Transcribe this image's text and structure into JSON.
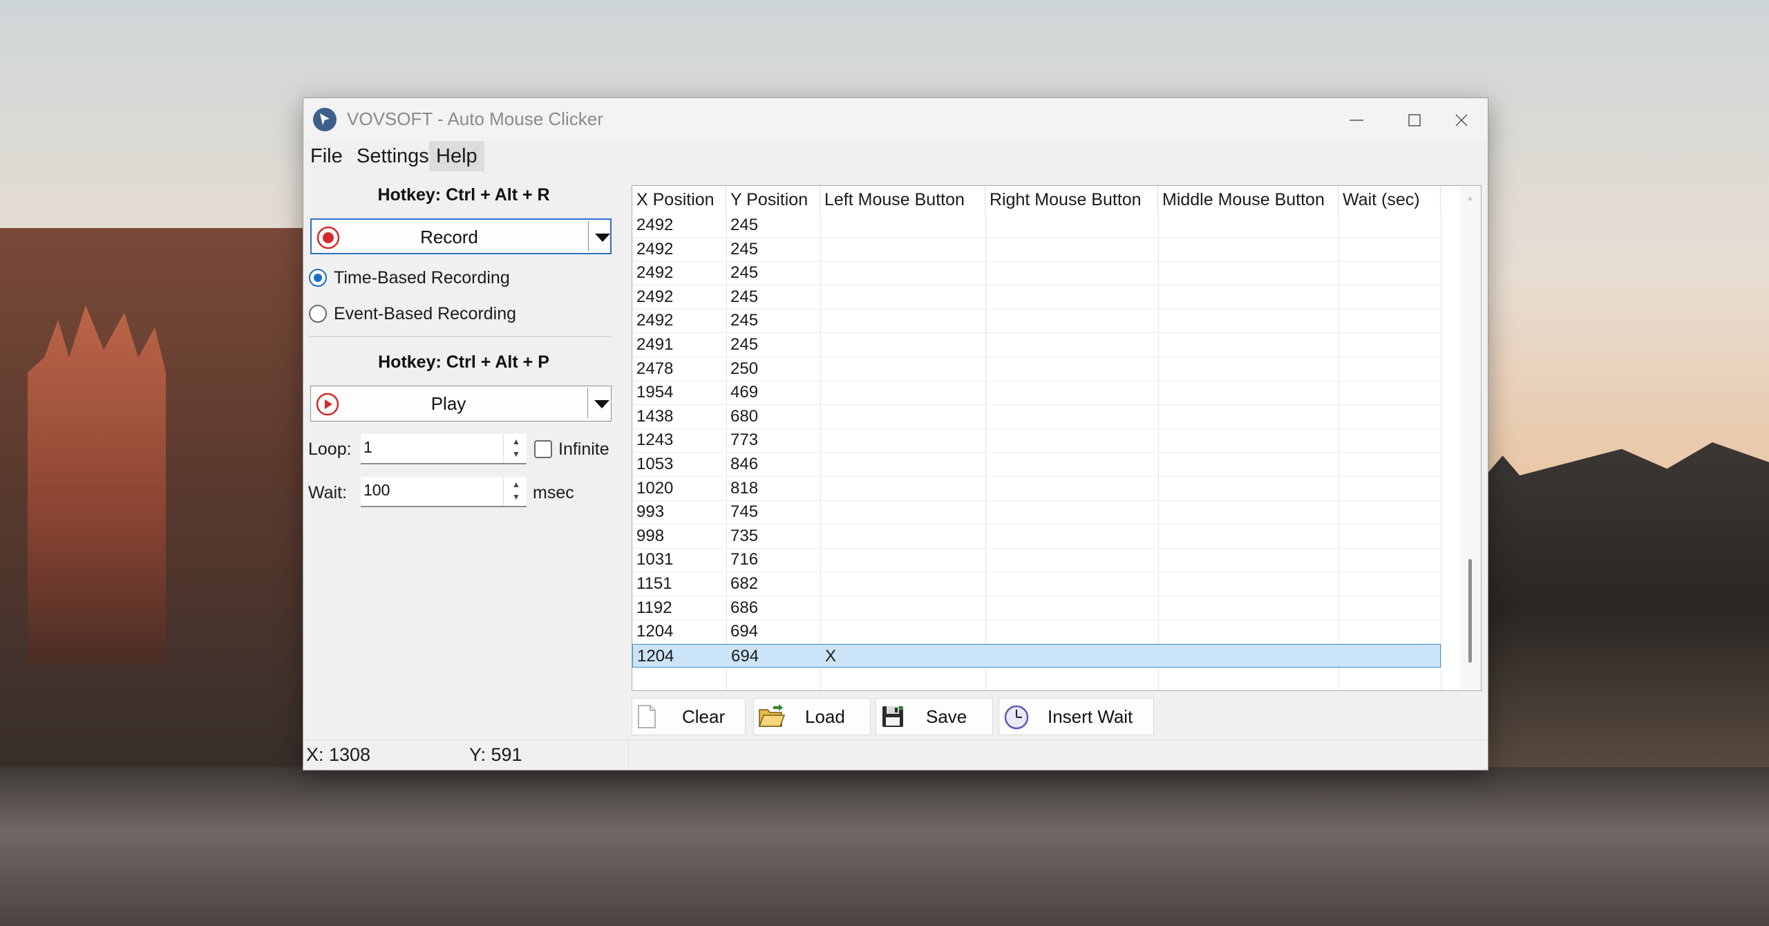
{
  "window": {
    "title": "VOVSOFT - Auto Mouse Clicker"
  },
  "menu": [
    "File",
    "Settings",
    "Help"
  ],
  "record": {
    "hotkey": "Hotkey: Ctrl + Alt + R",
    "button_label": "Record",
    "modes": [
      "Time-Based Recording",
      "Event-Based Recording"
    ],
    "selected_mode": "Time-Based Recording"
  },
  "play": {
    "hotkey": "Hotkey: Ctrl + Alt + P",
    "button_label": "Play",
    "loop_label": "Loop:",
    "loop_value": "1",
    "infinite_label": "Infinite",
    "infinite_checked": false,
    "wait_label": "Wait:",
    "wait_value": "100",
    "wait_unit": "msec"
  },
  "table": {
    "columns": [
      "X Position",
      "Y Position",
      "Left Mouse Button",
      "Right Mouse Button",
      "Middle Mouse Button",
      "Wait (sec)"
    ],
    "rows": [
      [
        "2492",
        "245",
        "",
        "",
        "",
        ""
      ],
      [
        "2492",
        "245",
        "",
        "",
        "",
        ""
      ],
      [
        "2492",
        "245",
        "",
        "",
        "",
        ""
      ],
      [
        "2492",
        "245",
        "",
        "",
        "",
        ""
      ],
      [
        "2492",
        "245",
        "",
        "",
        "",
        ""
      ],
      [
        "2491",
        "245",
        "",
        "",
        "",
        ""
      ],
      [
        "2478",
        "250",
        "",
        "",
        "",
        ""
      ],
      [
        "1954",
        "469",
        "",
        "",
        "",
        ""
      ],
      [
        "1438",
        "680",
        "",
        "",
        "",
        ""
      ],
      [
        "1243",
        "773",
        "",
        "",
        "",
        ""
      ],
      [
        "1053",
        "846",
        "",
        "",
        "",
        ""
      ],
      [
        "1020",
        "818",
        "",
        "",
        "",
        ""
      ],
      [
        "993",
        "745",
        "",
        "",
        "",
        ""
      ],
      [
        "998",
        "735",
        "",
        "",
        "",
        ""
      ],
      [
        "1031",
        "716",
        "",
        "",
        "",
        ""
      ],
      [
        "1151",
        "682",
        "",
        "",
        "",
        ""
      ],
      [
        "1192",
        "686",
        "",
        "",
        "",
        ""
      ],
      [
        "1204",
        "694",
        "",
        "",
        "",
        ""
      ],
      [
        "1204",
        "694",
        "X",
        "",
        "",
        ""
      ]
    ],
    "selected_row": 18
  },
  "toolbar": {
    "clear_label": "Clear",
    "load_label": "Load",
    "save_label": "Save",
    "insert_wait_label": "Insert Wait"
  },
  "status": {
    "x": "X: 1308",
    "y": "Y: 591"
  },
  "colors": {
    "accent": "#1a6bc9",
    "selection": "#cce4f7",
    "record_red": "#d22b2b"
  }
}
